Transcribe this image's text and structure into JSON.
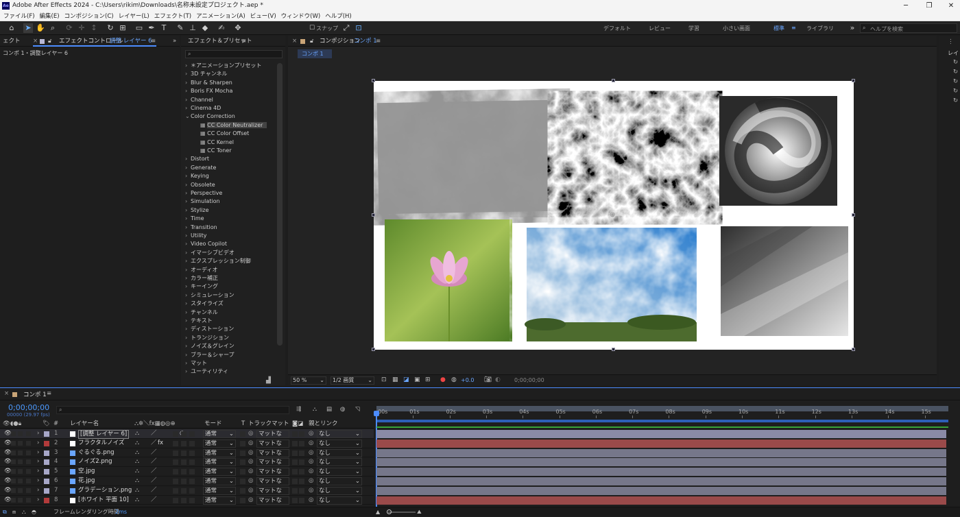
{
  "window": {
    "title": "Adobe After Effects 2024 - C:\\Users\\rikim\\Downloads\\名称未設定プロジェクト.aep *",
    "app_badge": "Ae"
  },
  "menu": [
    "ファイル(F)",
    "編集(E)",
    "コンポジション(C)",
    "レイヤー(L)",
    "エフェクト(T)",
    "アニメーション(A)",
    "ビュー(V)",
    "ウィンドウ(W)",
    "ヘルプ(H)"
  ],
  "toolbar": {
    "snap_label": "スナップ",
    "workspaces": [
      "デフォルト",
      "レビュー",
      "学習",
      "小さい画面",
      "標準",
      "ライブラリ"
    ],
    "active_workspace": "標準",
    "help_search_placeholder": "ヘルプを検索"
  },
  "left_panel": {
    "partial_tab": "ェクト",
    "tab_label": "エフェクトコントロール",
    "tab_target": "調整 レイヤー 6",
    "content": "コンポ 1・調整レイヤー 6"
  },
  "effects_panel": {
    "title": "エフェクト＆プリセット",
    "search_placeholder": "",
    "items": [
      {
        "label": "＊アニメーションプリセット",
        "open": false
      },
      {
        "label": "3D チャンネル",
        "open": false
      },
      {
        "label": "Blur & Sharpen",
        "open": false
      },
      {
        "label": "Boris FX Mocha",
        "open": false
      },
      {
        "label": "Channel",
        "open": false
      },
      {
        "label": "Cinema 4D",
        "open": false
      },
      {
        "label": "Color Correction",
        "open": true
      },
      {
        "label": "CC Color Neutralizer",
        "child": true,
        "selected": true
      },
      {
        "label": "CC Color Offset",
        "child": true
      },
      {
        "label": "CC Kernel",
        "child": true
      },
      {
        "label": "CC Toner",
        "child": true
      },
      {
        "label": "Distort"
      },
      {
        "label": "Generate"
      },
      {
        "label": "Keying"
      },
      {
        "label": "Obsolete"
      },
      {
        "label": "Perspective"
      },
      {
        "label": "Simulation"
      },
      {
        "label": "Stylize"
      },
      {
        "label": "Time"
      },
      {
        "label": "Transition"
      },
      {
        "label": "Utility"
      },
      {
        "label": "Video Copilot"
      },
      {
        "label": "イマーシブビデオ"
      },
      {
        "label": "エクスプレッション制御"
      },
      {
        "label": "オーディオ"
      },
      {
        "label": "カラー補正"
      },
      {
        "label": "キーイング"
      },
      {
        "label": "シミュレーション"
      },
      {
        "label": "スタイライズ"
      },
      {
        "label": "チャンネル"
      },
      {
        "label": "テキスト"
      },
      {
        "label": "ディストーション"
      },
      {
        "label": "トランジション"
      },
      {
        "label": "ノイズ＆グレイン"
      },
      {
        "label": "ブラー＆シャープ"
      },
      {
        "label": "マット"
      },
      {
        "label": "ユーティリティ"
      }
    ]
  },
  "composition_panel": {
    "tab_label": "コンポジション",
    "comp_name": "コンポ 1",
    "breadcrumb": "コンポ 1",
    "zoom": "50 %",
    "resolution": "1/2 画質",
    "exposure": "+0.0",
    "timecode": "0;00;00;00",
    "right_labels": [
      "レイ"
    ]
  },
  "timeline": {
    "tab_label": "コンポ 1",
    "timecode": "0;00;00;00",
    "frame_info": "00000 (29.97 fps)",
    "col_layer_name": "レイヤー名",
    "col_mode": "モード",
    "col_t": "T",
    "col_trackmatte": "トラックマット",
    "col_parent": "親とリンク",
    "ruler": [
      "00s",
      "01s",
      "02s",
      "03s",
      "04s",
      "05s",
      "06s",
      "07s",
      "08s",
      "09s",
      "10s",
      "11s",
      "12s",
      "13s",
      "14s",
      "15s"
    ],
    "layers": [
      {
        "num": "1",
        "name": "[調整 レイヤー 6]",
        "color": "#a7a7c8",
        "mode": "通常",
        "matte": "マットなし",
        "parent": "なし",
        "bar": "#8a8aa6",
        "fx": false
      },
      {
        "num": "2",
        "name": "フラクタルノイズ",
        "color": "#b33b3b",
        "mode": "通常",
        "matte": "マットなし",
        "parent": "なし",
        "bar": "#9a4a4a",
        "fx": true
      },
      {
        "num": "3",
        "name": "ぐるぐる.png",
        "color": "#a7a7c8",
        "mode": "通常",
        "matte": "マットなし",
        "parent": "なし",
        "bar": "#76778a",
        "fx": false
      },
      {
        "num": "4",
        "name": "ノイズ2.png",
        "color": "#a7a7c8",
        "mode": "通常",
        "matte": "マットなし",
        "parent": "なし",
        "bar": "#76778a",
        "fx": false
      },
      {
        "num": "5",
        "name": "空.jpg",
        "color": "#a7a7c8",
        "mode": "通常",
        "matte": "マットなし",
        "parent": "なし",
        "bar": "#76778a",
        "fx": false
      },
      {
        "num": "6",
        "name": "花.jpg",
        "color": "#a7a7c8",
        "mode": "通常",
        "matte": "マットなし",
        "parent": "なし",
        "bar": "#76778a",
        "fx": false
      },
      {
        "num": "7",
        "name": "グラデーション.png",
        "color": "#a7a7c8",
        "mode": "通常",
        "matte": "マットなし",
        "parent": "なし",
        "bar": "#76778a",
        "fx": false
      },
      {
        "num": "8",
        "name": "[ホワイト 平面 10]",
        "color": "#b33b3b",
        "mode": "通常",
        "matte": "マットなし",
        "parent": "なし",
        "bar": "#9a4a4a",
        "fx": false
      }
    ],
    "footer_label": "フレームレンダリング時間",
    "footer_value": "2ms"
  }
}
